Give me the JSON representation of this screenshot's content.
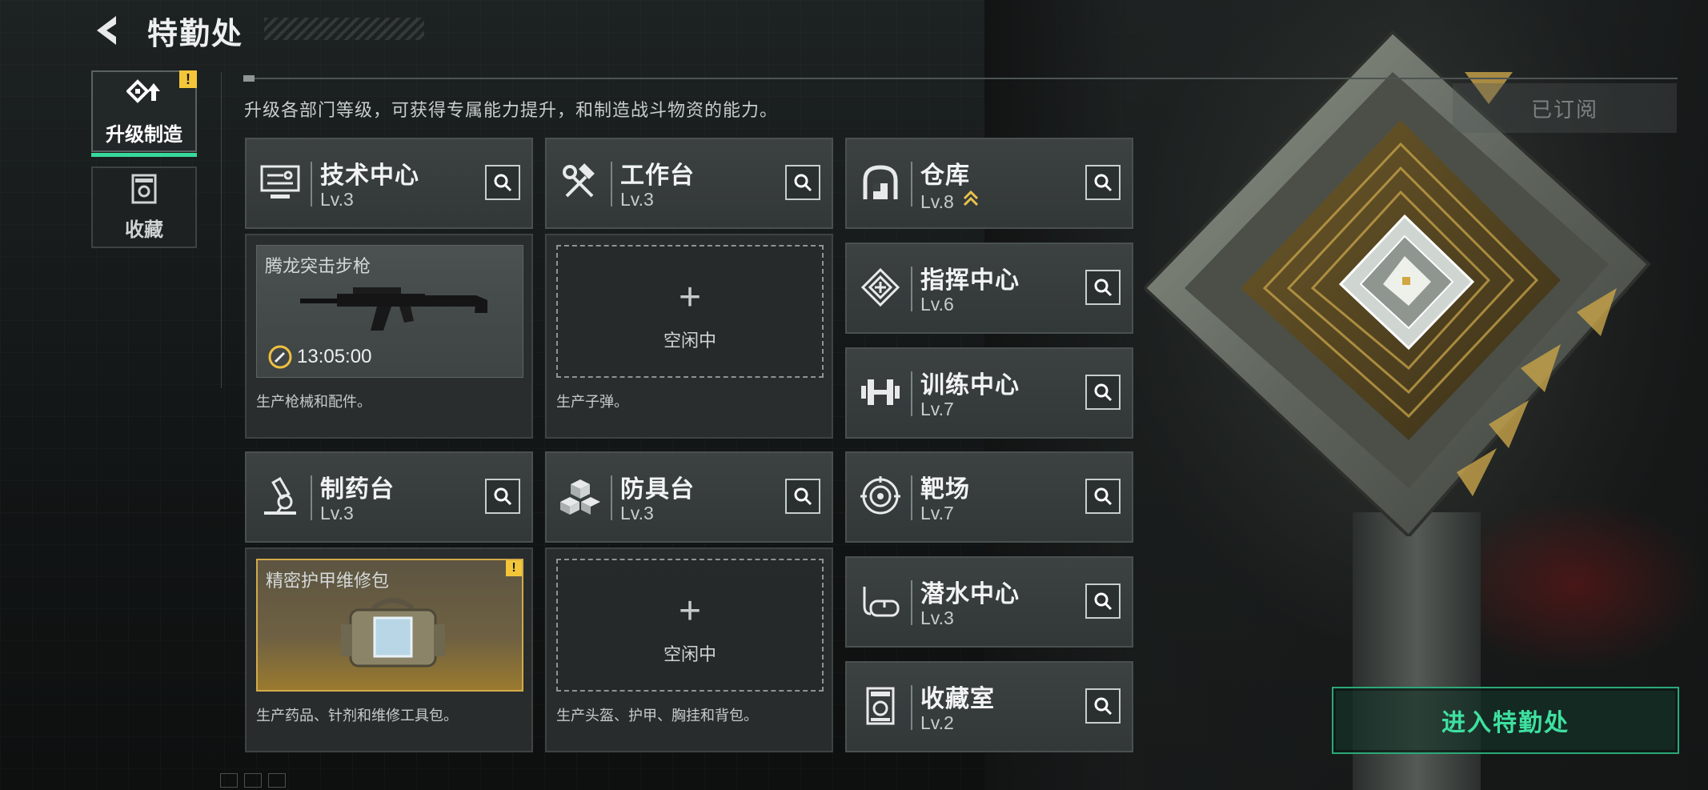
{
  "header": {
    "title": "特勤处"
  },
  "tabs": [
    {
      "label": "升级制造",
      "active": true,
      "badge": "!"
    },
    {
      "label": "收藏",
      "active": false
    }
  ],
  "description": "升级各部门等级，可获得专属能力提升，和制造战斗物资的能力。",
  "subscribed_label": "已订阅",
  "enter_label": "进入特勤处",
  "departments": {
    "tech": {
      "name": "技术中心",
      "level": "Lv.3",
      "icon": "tech-center-icon"
    },
    "workbench": {
      "name": "工作台",
      "level": "Lv.3",
      "icon": "wrench-hammer-icon"
    },
    "pharmacy": {
      "name": "制药台",
      "level": "Lv.3",
      "icon": "microscope-icon"
    },
    "armor": {
      "name": "防具台",
      "level": "Lv.3",
      "icon": "cubes-icon"
    },
    "warehouse": {
      "name": "仓库",
      "level": "Lv.8",
      "icon": "warehouse-icon",
      "upgradable": true
    },
    "command": {
      "name": "指挥中心",
      "level": "Lv.6",
      "icon": "command-icon"
    },
    "training": {
      "name": "训练中心",
      "level": "Lv.7",
      "icon": "dumbbell-icon"
    },
    "range": {
      "name": "靶场",
      "level": "Lv.7",
      "icon": "target-icon"
    },
    "diving": {
      "name": "潜水中心",
      "level": "Lv.3",
      "icon": "diving-mask-icon"
    },
    "collection": {
      "name": "收藏室",
      "level": "Lv.2",
      "icon": "collection-icon"
    }
  },
  "slots": {
    "tech": {
      "item_name": "腾龙突击步枪",
      "timer": "13:05:00",
      "desc": "生产枪械和配件。"
    },
    "workbench": {
      "idle_label": "空闲中",
      "plus": "+",
      "desc": "生产子弹。"
    },
    "pharmacy": {
      "item_name": "精密护甲维修包",
      "warn": "!",
      "desc": "生产药品、针剂和维修工具包。"
    },
    "armor": {
      "idle_label": "空闲中",
      "plus": "+",
      "desc": "生产头盔、护甲、胸挂和背包。"
    }
  },
  "colors": {
    "accent_green": "#37d99a",
    "warning_yellow": "#f3c63a",
    "rare_gold": "#d3a94a"
  }
}
